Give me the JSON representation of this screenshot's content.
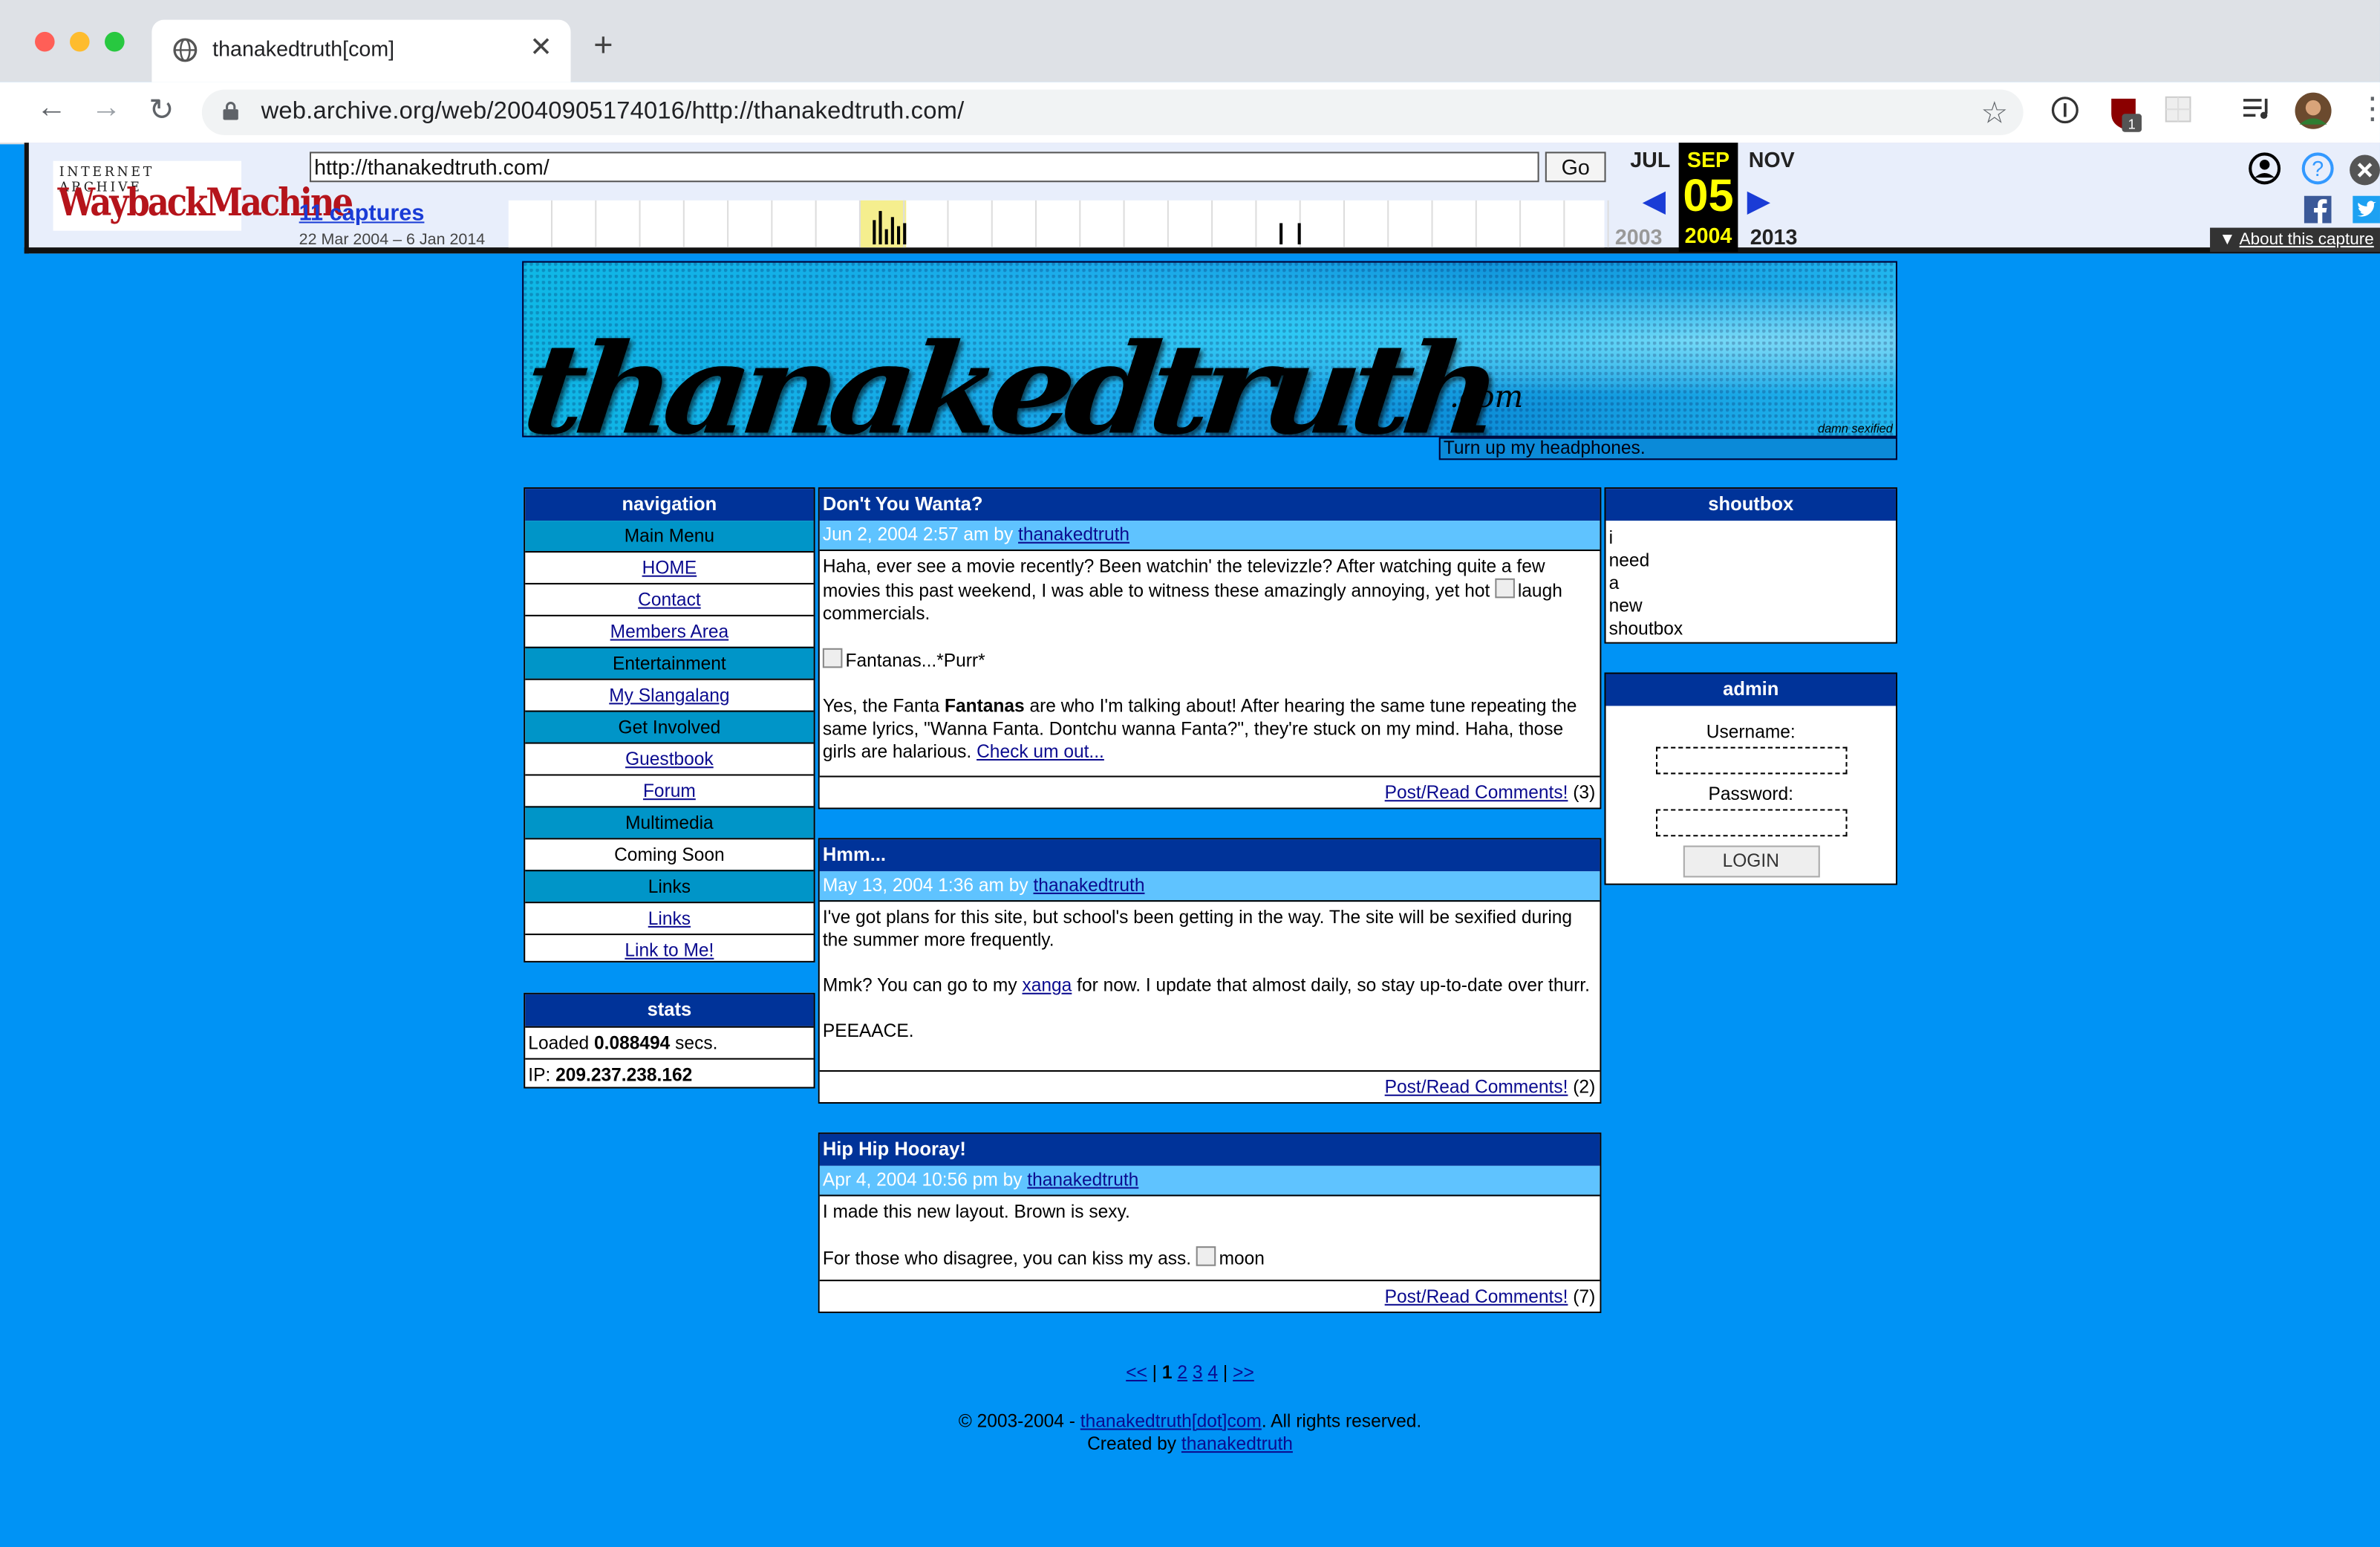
{
  "browser": {
    "tab_title": "thanakedtruth[com]",
    "url": "web.archive.org/web/20040905174016/http://thanakedtruth.com/",
    "extension_badge": "1"
  },
  "wayback": {
    "logo_line1": "INTERNET ARCHIVE",
    "logo_line2": "WaybackMachine",
    "url_value": "http://thanakedtruth.com/",
    "go_label": "Go",
    "captures_label": "11 captures",
    "date_range": "22 Mar 2004 – 6 Jan 2014",
    "prev_month": "JUL",
    "current_month": "SEP",
    "next_month": "NOV",
    "current_day": "05",
    "prev_year": "2003",
    "current_year": "2004",
    "next_year": "2013",
    "about_label": "About this capture"
  },
  "banner": {
    "logo_text": "thanakedtruth",
    "logo_suffix": ".com",
    "credit": "damn sexified",
    "tagline": "Turn up my headphones."
  },
  "navigation": {
    "title": "navigation",
    "sections": [
      {
        "label": "Main Menu",
        "items": [
          "HOME",
          "Contact",
          "Members Area"
        ]
      },
      {
        "label": "Entertainment",
        "items": [
          "My Slangalang"
        ]
      },
      {
        "label": "Get Involved",
        "items": [
          "Guestbook",
          "Forum"
        ]
      },
      {
        "label": "Multimedia",
        "items": [
          "Coming Soon"
        ]
      },
      {
        "label": "Links",
        "items": [
          "Links",
          "Link to Me!"
        ]
      }
    ]
  },
  "stats": {
    "title": "stats",
    "loaded_prefix": "Loaded",
    "loaded_value": "0.088494",
    "loaded_suffix": "secs.",
    "ip_label": "IP:",
    "ip_value": "209.237.238.162"
  },
  "posts": [
    {
      "title": "Don't You Wanta?",
      "date": "Jun 2, 2004 2:57 am by",
      "author": "thanakedtruth",
      "p1": "Haha, ever see a movie recently? Been watchin' the televizzle? After watching quite a few movies this past weekend, I was able to witness these amazingly annoying, yet hot",
      "p1_img_alt": "laugh",
      "p1_end": "commercials.",
      "img2_alt": "Fantanas...*Purr*",
      "p3_a": "Yes, the Fanta",
      "p3_bold": "Fantanas",
      "p3_b": "are who I'm talking about! After hearing the same tune repeating the same lyrics, \"Wanna Fanta. Dontchu wanna Fanta?\", they're stuck on my mind. Haha, those girls are halarious.",
      "p3_link": "Check um out...",
      "comments_link": "Post/Read Comments!",
      "comments_count": "(3)"
    },
    {
      "title": "Hmm...",
      "date": "May 13, 2004 1:36 am by",
      "author": "thanakedtruth",
      "p1": "I've got plans for this site, but school's been getting in the way. The site will be sexified during the summer more frequently.",
      "p2_a": "Mmk? You can go to my",
      "p2_link": "xanga",
      "p2_b": "for now. I update that almost daily, so stay up-to-date over thurr.",
      "p3": "PEEAACE.",
      "comments_link": "Post/Read Comments!",
      "comments_count": "(2)"
    },
    {
      "title": "Hip Hip Hooray!",
      "date": "Apr 4, 2004 10:56 pm by",
      "author": "thanakedtruth",
      "p1": "I made this new layout. Brown is sexy.",
      "p2": "For those who disagree, you can kiss my ass.",
      "p2_img_alt": "moon",
      "comments_link": "Post/Read Comments!",
      "comments_count": "(7)"
    }
  ],
  "shoutbox": {
    "title": "shoutbox",
    "lines": [
      "i",
      "need",
      "a",
      "new",
      "shoutbox"
    ]
  },
  "admin": {
    "title": "admin",
    "username_label": "Username:",
    "password_label": "Password:",
    "login_label": "LOGIN"
  },
  "pager": {
    "prev": "<<",
    "sep": "|",
    "current": "1",
    "pages": [
      "2",
      "3",
      "4"
    ],
    "next": ">>"
  },
  "footer": {
    "copyright_prefix": "© 2003-2004 -",
    "site_link": "thanakedtruth[dot]com",
    "copyright_suffix": ". All rights reserved.",
    "created_by": "Created by",
    "creator_link": "thanakedtruth"
  }
}
